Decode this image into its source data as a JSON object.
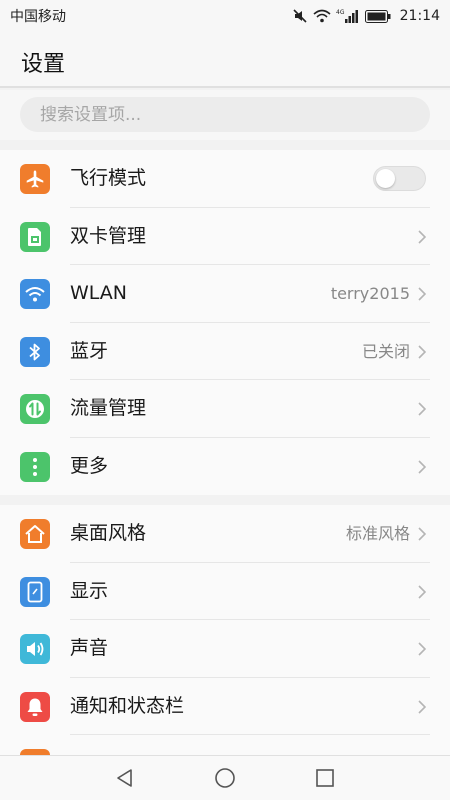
{
  "status_bar": {
    "carrier": "中国移动",
    "network_badge": "4G",
    "time": "21:14",
    "icons": [
      "mute-icon",
      "wifi-icon",
      "cellular-signal-icon",
      "battery-icon"
    ]
  },
  "header": {
    "title": "设置"
  },
  "search": {
    "placeholder": "搜索设置项..."
  },
  "colors": {
    "airplane": "#f07d2c",
    "sim": "#4cc46b",
    "wlan": "#3e8ee0",
    "bluetooth": "#3e8ee0",
    "data_usage": "#4cc46b",
    "more": "#4cc46b",
    "home_screen": "#f07d2c",
    "display": "#3e8ee0",
    "sound": "#3fb8d8",
    "notification": "#ee4b45"
  },
  "group1": {
    "airplane": {
      "label": "飞行模式",
      "icon": "airplane-icon",
      "toggle_on": false
    },
    "sim": {
      "label": "双卡管理",
      "icon": "sim-card-icon"
    },
    "wlan": {
      "label": "WLAN",
      "value": "terry2015",
      "icon": "wifi-icon"
    },
    "bluetooth": {
      "label": "蓝牙",
      "value": "已关闭",
      "icon": "bluetooth-icon"
    },
    "data_usage": {
      "label": "流量管理",
      "icon": "data-transfer-icon"
    },
    "more": {
      "label": "更多",
      "icon": "more-dots-icon"
    }
  },
  "group2": {
    "home_screen": {
      "label": "桌面风格",
      "value": "标准风格",
      "icon": "home-icon"
    },
    "display": {
      "label": "显示",
      "icon": "display-icon"
    },
    "sound": {
      "label": "声音",
      "icon": "speaker-icon"
    },
    "notification": {
      "label": "通知和状态栏",
      "icon": "bell-icon"
    }
  },
  "nav_bar": {
    "buttons": [
      "back-icon",
      "home-circle-icon",
      "recent-apps-icon"
    ]
  }
}
